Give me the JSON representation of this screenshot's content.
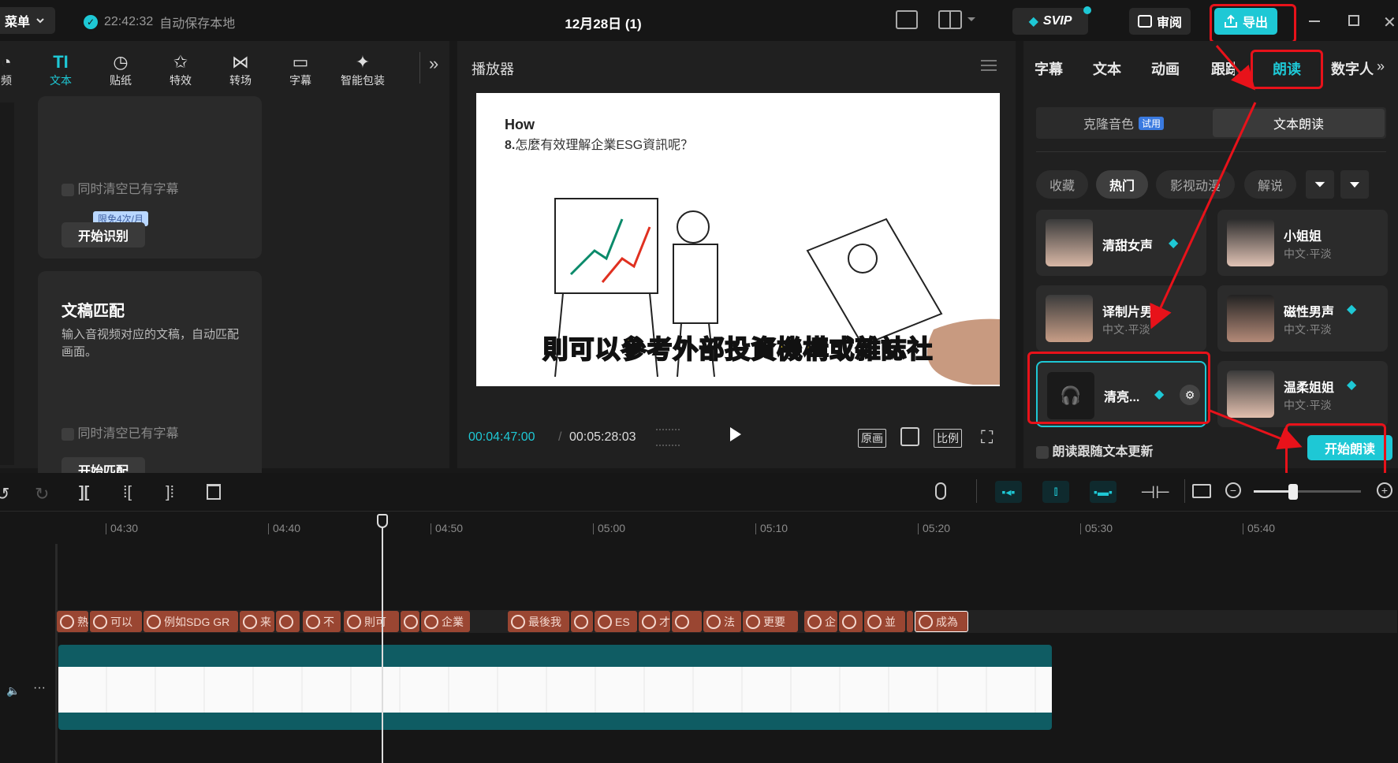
{
  "topbar": {
    "menu_label": "菜单",
    "autosave_time": "22:42:32",
    "autosave_text": "自动保存本地",
    "project_title": "12月28日 (1)",
    "svip_label": "SVIP",
    "review_label": "审阅",
    "export_label": "导出"
  },
  "tools": [
    {
      "label": "频",
      "icon": "audio-icon"
    },
    {
      "label": "文本",
      "icon": "text-icon"
    },
    {
      "label": "贴纸",
      "icon": "sticker-icon"
    },
    {
      "label": "特效",
      "icon": "effects-icon"
    },
    {
      "label": "转场",
      "icon": "transition-icon"
    },
    {
      "label": "字幕",
      "icon": "subtitle-icon"
    },
    {
      "label": "智能包装",
      "icon": "smart-pack-icon"
    }
  ],
  "recognize_card": {
    "clear_label": "同时清空已有字幕",
    "badge": "限免4次/月",
    "button": "开始识别"
  },
  "manuscript_card": {
    "title": "文稿匹配",
    "desc": "输入音视频对应的文稿，自动匹配画面。",
    "clear_label": "同时清空已有字幕",
    "button": "开始匹配"
  },
  "player": {
    "title": "播放器",
    "video_heading": "How",
    "video_question_num": "8.",
    "video_question": "怎麼有效理解企業ESG資訊呢？",
    "subtitle": "則可以參考外部投資機構或雜誌社",
    "current_time": "00:04:47:00",
    "total_time": "00:05:28:03",
    "btn_original": "原画",
    "btn_ratio": "比例"
  },
  "right_panel": {
    "tabs": [
      "字幕",
      "文本",
      "动画",
      "跟踪",
      "朗读",
      "数字人"
    ],
    "active_tab": "朗读",
    "subtabs": {
      "clone": "克隆音色",
      "clone_badge": "试用",
      "tts": "文本朗读"
    },
    "filters": [
      "收藏",
      "热门",
      "影视动漫",
      "解说"
    ],
    "active_filter": "热门",
    "voices": [
      {
        "name": "清甜女声",
        "sub": "",
        "vip": true
      },
      {
        "name": "小姐姐",
        "sub": "中文·平淡",
        "vip": false
      },
      {
        "name": "译制片男",
        "sub": "中文·平淡",
        "vip": false
      },
      {
        "name": "磁性男声",
        "sub": "中文·平淡",
        "vip": true
      },
      {
        "name": "清亮...",
        "sub": "",
        "vip": true
      },
      {
        "name": "温柔姐姐",
        "sub": "中文·平淡",
        "vip": true
      }
    ],
    "follow_update_label": "朗读跟随文本更新",
    "start_button": "开始朗读"
  },
  "timeline": {
    "ticks": [
      "04:30",
      "04:40",
      "04:50",
      "05:00",
      "05:10",
      "05:20",
      "05:30",
      "05:40"
    ],
    "clips": [
      "熟",
      "可以",
      "例如SDG GR",
      "来",
      "",
      "不",
      "則可",
      "",
      "企業",
      "最後我",
      "",
      "ES",
      "才",
      "",
      "法",
      "更要",
      "企",
      "",
      "並",
      "",
      "成為"
    ]
  },
  "colors": {
    "accent": "#1ec8d5",
    "vip": "#1ec8d5",
    "highlight": "#e8121a",
    "clip": "#9a4632",
    "track": "#0f5c63"
  }
}
